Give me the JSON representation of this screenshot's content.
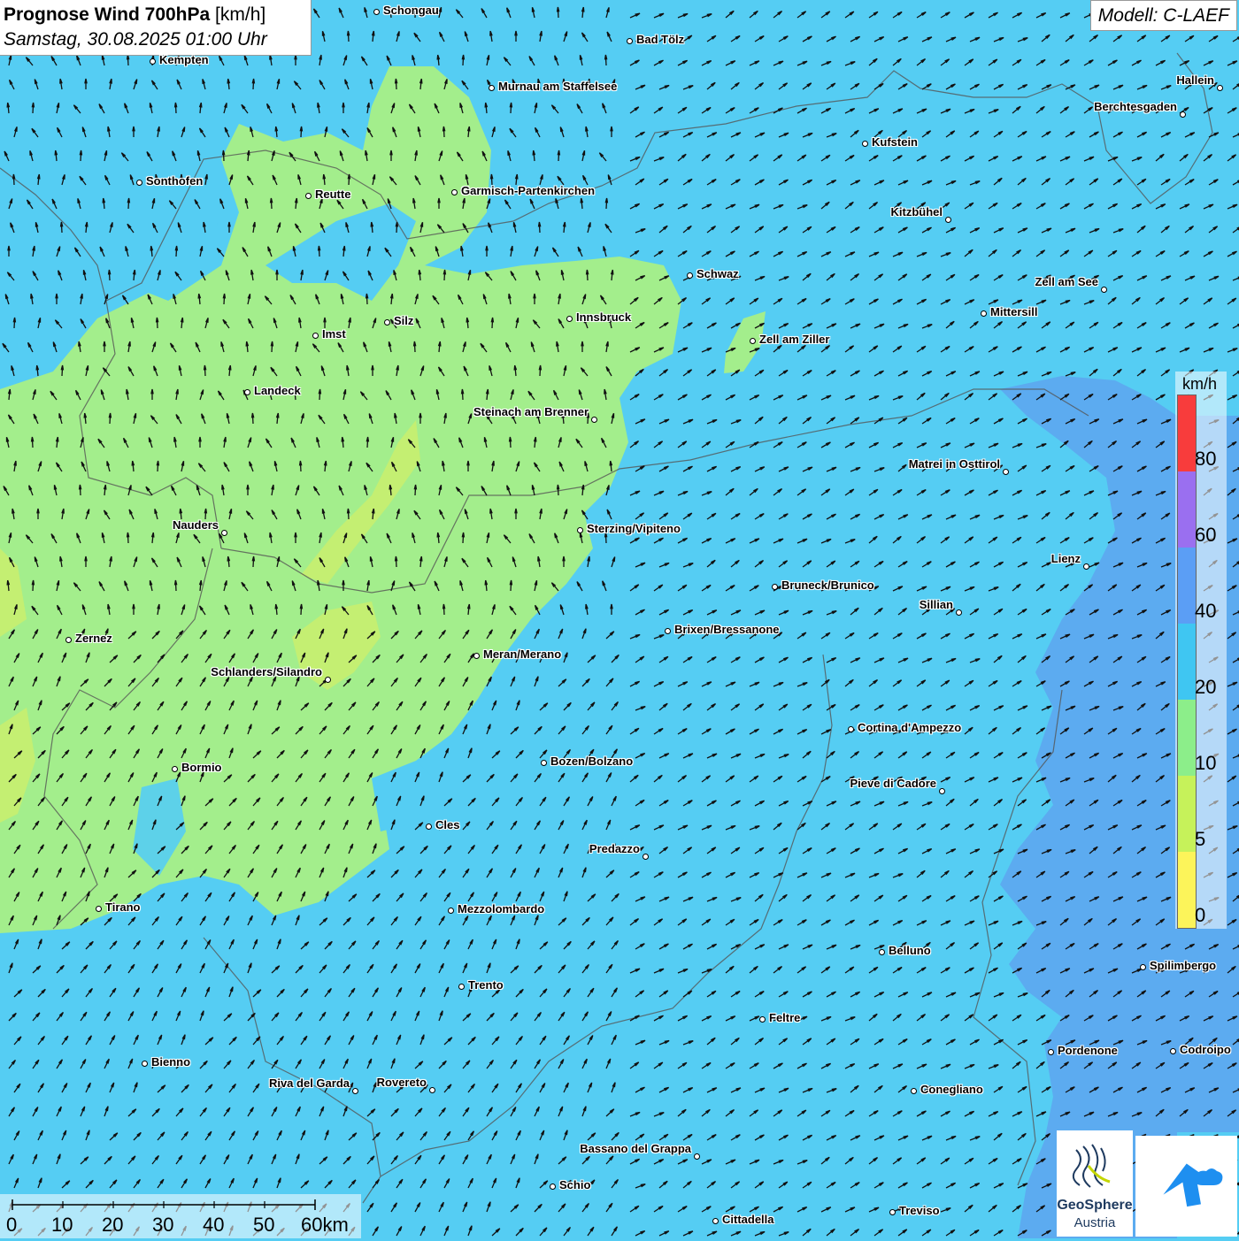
{
  "header": {
    "title_bold": "Prognose Wind 700hPa",
    "title_unit": "[km/h]",
    "subtitle": "Samstag, 30.08.2025 01:00 Uhr"
  },
  "model_label": "Modell: C-LAEF",
  "colors": {
    "background": "#55cdf3",
    "green": "#a3ee8c",
    "yellow_green": "#c4ef72",
    "blue": "#5ea4ee",
    "border": "#555555"
  },
  "legend": {
    "unit": "km/h",
    "labels": [
      "80",
      "60",
      "40",
      "20",
      "10",
      "5",
      "0"
    ],
    "colors": [
      "#f83c3c",
      "#9a6ff0",
      "#5b9ef5",
      "#3fc6f2",
      "#8cee8a",
      "#c6f25a",
      "#fcf45a"
    ]
  },
  "scalebar": {
    "labels": [
      "0",
      "10",
      "20",
      "30",
      "40",
      "50",
      "60km"
    ]
  },
  "cities": [
    {
      "name": "Schongau",
      "label_side": "right"
    },
    {
      "name": "Bad Tölz",
      "label_side": "right"
    },
    {
      "name": "Kempten",
      "label_side": "right"
    },
    {
      "name": "Murnau am Staffelsee",
      "label_side": "right"
    },
    {
      "name": "Hallein",
      "label_side": "left"
    },
    {
      "name": "Berchtesgaden",
      "label_side": "left"
    },
    {
      "name": "Kufstein",
      "label_side": "right"
    },
    {
      "name": "Sonthofen",
      "label_side": "right"
    },
    {
      "name": "Reutte",
      "label_side": "right"
    },
    {
      "name": "Garmisch-Partenkirchen",
      "label_side": "right"
    },
    {
      "name": "Kitzbühel",
      "label_side": "left"
    },
    {
      "name": "Schwaz",
      "label_side": "right"
    },
    {
      "name": "Zell am See",
      "label_side": "left"
    },
    {
      "name": "Mittersill",
      "label_side": "right"
    },
    {
      "name": "Innsbruck",
      "label_side": "right"
    },
    {
      "name": "Imst",
      "label_side": "right"
    },
    {
      "name": "Silz",
      "label_side": "right"
    },
    {
      "name": "Zell am Ziller",
      "label_side": "right"
    },
    {
      "name": "Landeck",
      "label_side": "right"
    },
    {
      "name": "Steinach am Brenner",
      "label_side": "left"
    },
    {
      "name": "Matrei in Osttirol",
      "label_side": "left"
    },
    {
      "name": "Nauders",
      "label_side": "left"
    },
    {
      "name": "Sterzing/Vipiteno",
      "label_side": "right"
    },
    {
      "name": "Lienz",
      "label_side": "left"
    },
    {
      "name": "Bruneck/Brunico",
      "label_side": "right"
    },
    {
      "name": "Sillian",
      "label_side": "left"
    },
    {
      "name": "Brixen/Bressanone",
      "label_side": "right"
    },
    {
      "name": "Zernez",
      "label_side": "right"
    },
    {
      "name": "Meran/Merano",
      "label_side": "right"
    },
    {
      "name": "Schlanders/Silandro",
      "label_side": "left"
    },
    {
      "name": "Cortina d'Ampezzo",
      "label_side": "right"
    },
    {
      "name": "Bozen/Bolzano",
      "label_side": "right"
    },
    {
      "name": "Bormio",
      "label_side": "right"
    },
    {
      "name": "Pieve di Cadore",
      "label_side": "left"
    },
    {
      "name": "Cles",
      "label_side": "right"
    },
    {
      "name": "Predazzo",
      "label_side": "left"
    },
    {
      "name": "Tirano",
      "label_side": "right"
    },
    {
      "name": "Mezzolombardo",
      "label_side": "right"
    },
    {
      "name": "Belluno",
      "label_side": "right"
    },
    {
      "name": "Spilimbergo",
      "label_side": "right"
    },
    {
      "name": "Trento",
      "label_side": "right"
    },
    {
      "name": "Feltre",
      "label_side": "right"
    },
    {
      "name": "Pordenone",
      "label_side": "right"
    },
    {
      "name": "Codroipo",
      "label_side": "right"
    },
    {
      "name": "Bienno",
      "label_side": "right"
    },
    {
      "name": "Riva del Garda",
      "label_side": "left"
    },
    {
      "name": "Rovereto",
      "label_side": "left"
    },
    {
      "name": "Conegliano",
      "label_side": "right"
    },
    {
      "name": "Bassano del Grappa",
      "label_side": "left"
    },
    {
      "name": "Schio",
      "label_side": "right"
    },
    {
      "name": "Treviso",
      "label_side": "right"
    },
    {
      "name": "Cittadella",
      "label_side": "right"
    }
  ],
  "logos": {
    "geosphere_line1": "GeoSphere",
    "geosphere_line2": "Austria"
  }
}
